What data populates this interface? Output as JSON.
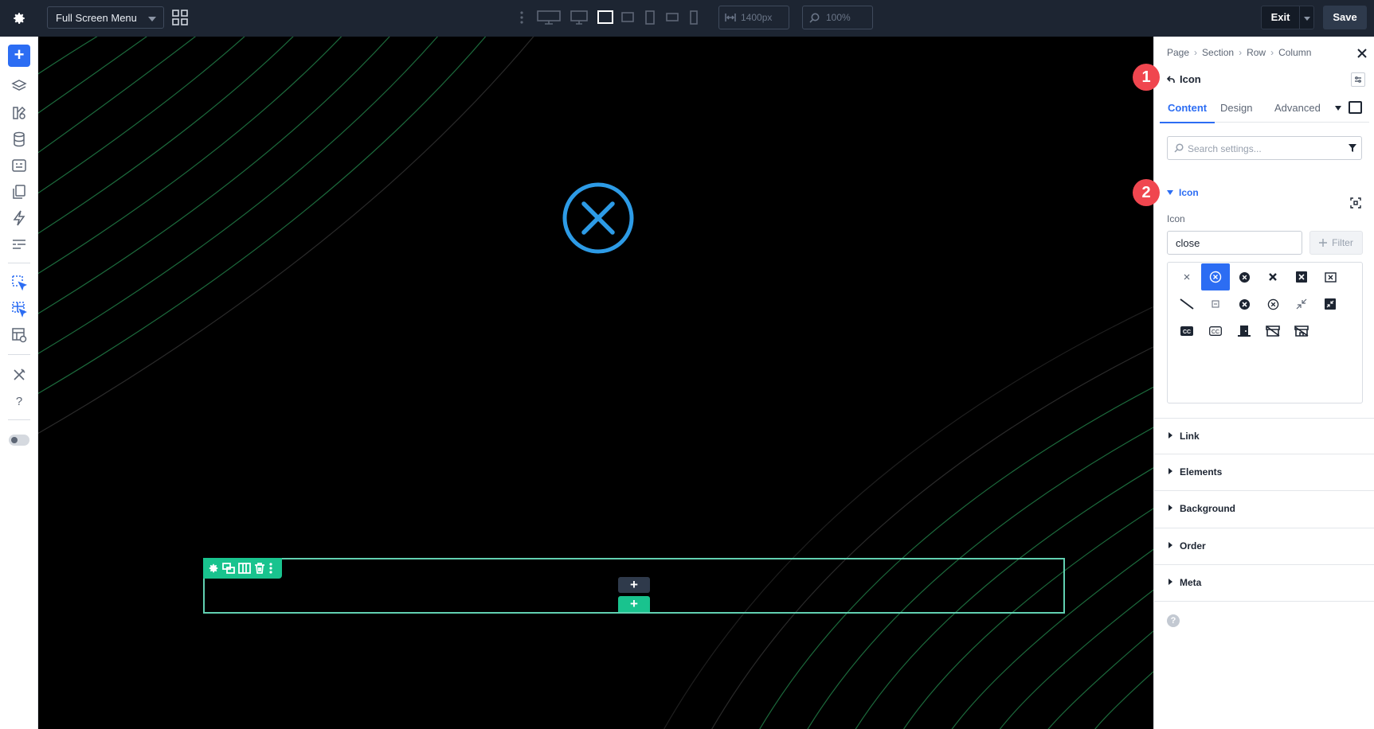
{
  "topbar": {
    "page_name": "Full Screen Menu",
    "width_value": "1400px",
    "zoom_value": "100%",
    "exit_label": "Exit",
    "save_label": "Save"
  },
  "canvas": {
    "add_label": "+",
    "add_row_label": "+"
  },
  "panel": {
    "breadcrumbs": [
      "Page",
      "Section",
      "Row",
      "Column"
    ],
    "crumb_sep": "›",
    "module_title": "Icon",
    "tabs": [
      "Content",
      "Design",
      "Advanced"
    ],
    "search_placeholder": "Search settings...",
    "group_title": "Icon",
    "field_label": "Icon",
    "field_value": "close",
    "filter_label": "Filter",
    "sections": [
      "Link",
      "Elements",
      "Background",
      "Order",
      "Meta"
    ],
    "help_label": "?"
  },
  "badges": [
    "1",
    "2"
  ],
  "colors": {
    "topbar": "#1d2532",
    "accent_blue": "#2c6df3",
    "row_green": "#19c38e",
    "icon_blue": "#2d9be6",
    "badge_red": "#f0464f"
  }
}
